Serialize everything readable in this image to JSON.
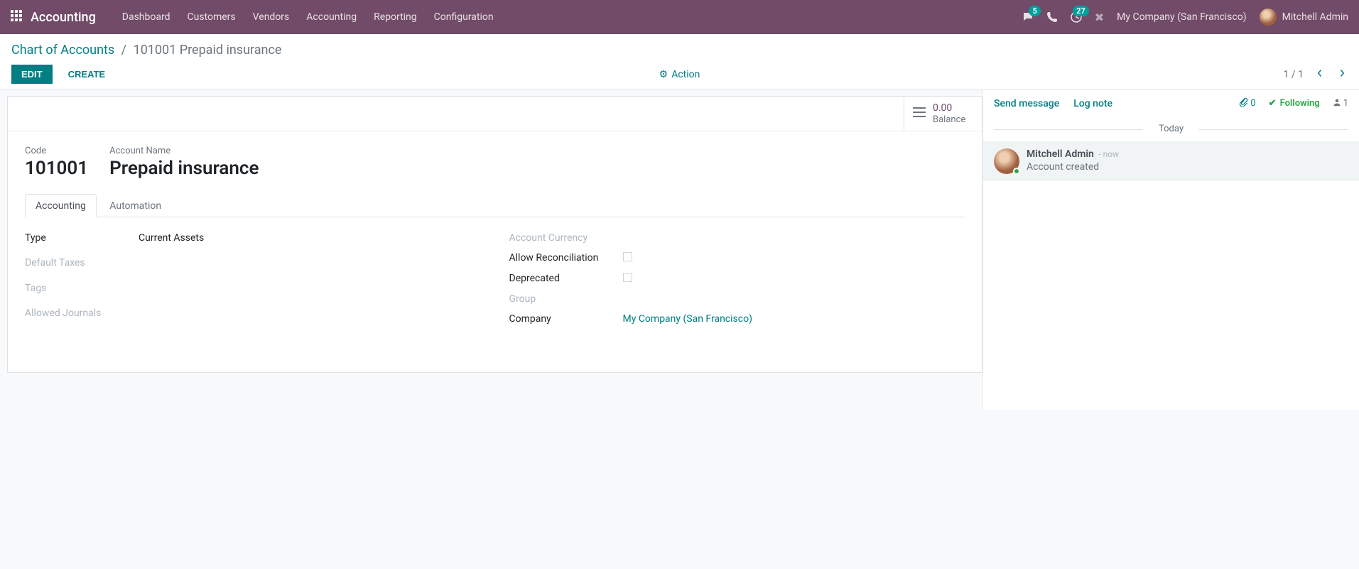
{
  "navbar": {
    "brand": "Accounting",
    "menu": [
      "Dashboard",
      "Customers",
      "Vendors",
      "Accounting",
      "Reporting",
      "Configuration"
    ],
    "messages_badge": "5",
    "activities_badge": "27",
    "company": "My Company (San Francisco)",
    "user": "Mitchell Admin"
  },
  "breadcrumb": {
    "parent": "Chart of Accounts",
    "current": "101001 Prepaid insurance"
  },
  "buttons": {
    "edit": "EDIT",
    "create": "CREATE",
    "action": "Action"
  },
  "pager": {
    "text": "1 / 1"
  },
  "stat": {
    "balance_value": "0.00",
    "balance_label": "Balance"
  },
  "record": {
    "code_label": "Code",
    "code": "101001",
    "name_label": "Account Name",
    "name": "Prepaid insurance"
  },
  "tabs": {
    "accounting": "Accounting",
    "automation": "Automation"
  },
  "fields": {
    "type_label": "Type",
    "type_value": "Current Assets",
    "default_taxes_label": "Default Taxes",
    "tags_label": "Tags",
    "allowed_journals_label": "Allowed Journals",
    "currency_label": "Account Currency",
    "allow_reconciliation_label": "Allow Reconciliation",
    "deprecated_label": "Deprecated",
    "group_label": "Group",
    "company_label": "Company",
    "company_value": "My Company (San Francisco)"
  },
  "chatter": {
    "send_message": "Send message",
    "log_note": "Log note",
    "attachments_count": "0",
    "following": "Following",
    "followers_count": "1",
    "date_sep": "Today",
    "msg_author": "Mitchell Admin",
    "msg_time": "- now",
    "msg_text": "Account created"
  }
}
